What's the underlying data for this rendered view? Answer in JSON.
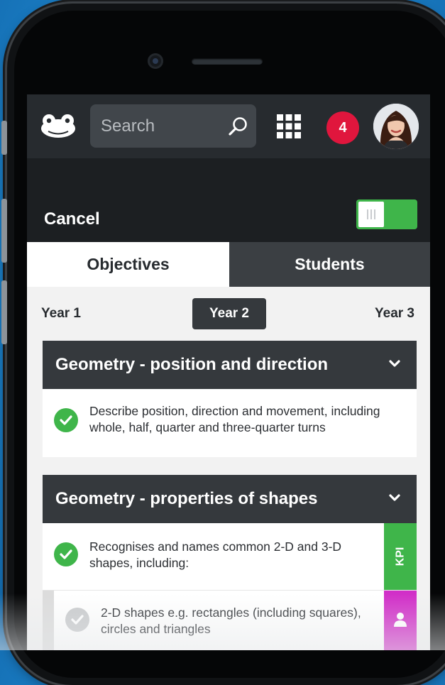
{
  "header": {
    "search_placeholder": "Search",
    "notification_count": "4"
  },
  "toolbar": {
    "cancel_label": "Cancel",
    "toggle_state": "on"
  },
  "tabs": [
    {
      "label": "Objectives",
      "active": true
    },
    {
      "label": "Students",
      "active": false
    }
  ],
  "years": [
    {
      "label": "Year 1",
      "active": false
    },
    {
      "label": "Year 2",
      "active": true
    },
    {
      "label": "Year 3",
      "active": false
    }
  ],
  "sections": [
    {
      "title": "Geometry - position and direction",
      "items": [
        {
          "text": "Describe position, direction and movement, including whole, half, quarter and three-quarter turns",
          "checked": true
        }
      ]
    },
    {
      "title": "Geometry - properties of shapes",
      "items": [
        {
          "text": "Recognises and names common 2-D and 3-D shapes, including:",
          "checked": true,
          "tag": "KPI"
        },
        {
          "text": "2-D shapes e.g. rectangles (including squares), circles and triangles",
          "checked": false,
          "tag": "person-icon"
        }
      ]
    }
  ],
  "colors": {
    "accent_green": "#3fb54a",
    "badge_red": "#e0163d",
    "tag_magenta": "#d12fc8",
    "header_dark": "#272b2f"
  }
}
